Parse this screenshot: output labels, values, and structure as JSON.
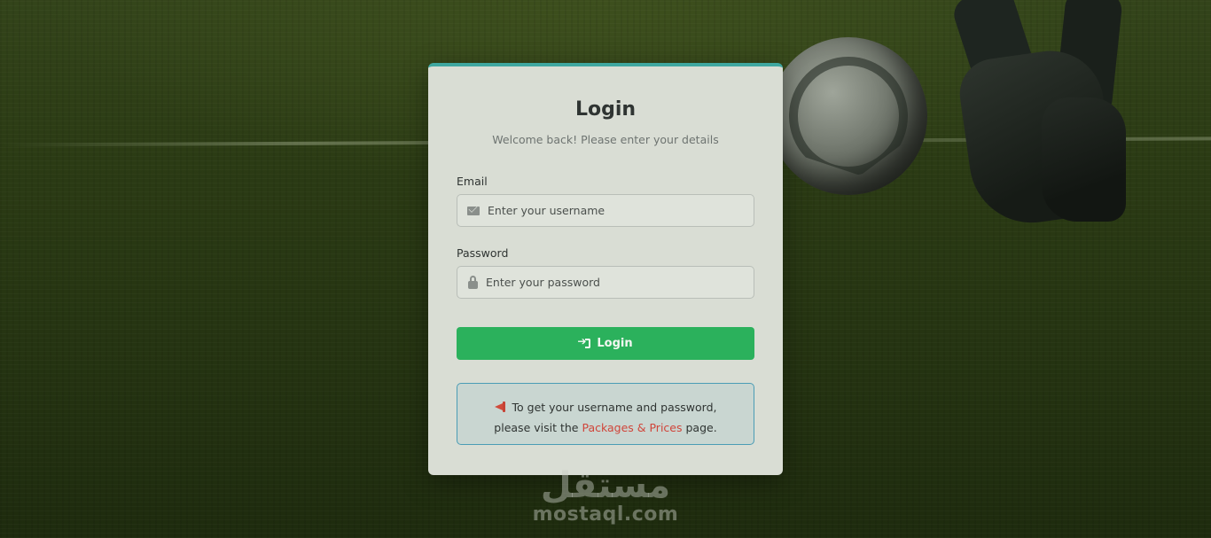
{
  "login": {
    "title": "Login",
    "subtitle": "Welcome back! Please enter your details",
    "email_label": "Email",
    "email_placeholder": "Enter your username",
    "email_value": "",
    "password_label": "Password",
    "password_placeholder": "Enter your password",
    "password_value": "",
    "button_label": "Login",
    "button_color": "#2bb15c",
    "accent_color": "#3fa7a0"
  },
  "info": {
    "line1": "To get your username and password,",
    "line2_prefix": "please visit the",
    "link_text": "Packages & Prices",
    "line2_suffix": "page.",
    "link_color": "#d0453a"
  },
  "icons": {
    "email": "envelope-icon",
    "password": "lock-icon",
    "login": "sign-in-icon",
    "info": "megaphone-icon"
  },
  "watermark": {
    "arabic": "مستقل",
    "latin": "mostaql.com"
  }
}
